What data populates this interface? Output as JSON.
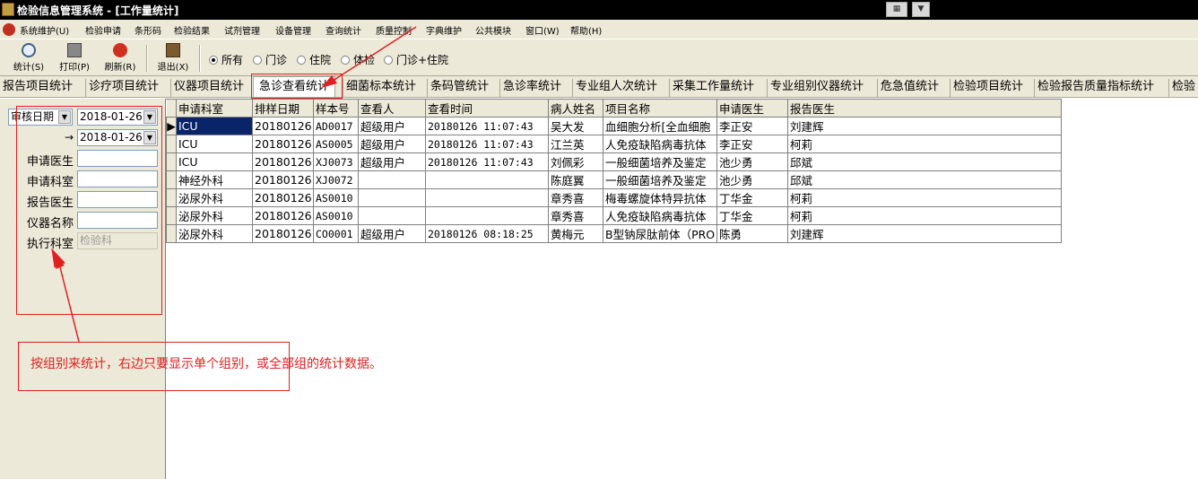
{
  "window": {
    "title": "检验信息管理系统 - [工作量统计]"
  },
  "menu": [
    "系统维护(U)",
    "检验申请",
    "条形码",
    "检验结果",
    "试剂管理",
    "设备管理",
    "查询统计",
    "质量控制",
    "字典维护",
    "公共模块",
    "窗口(W)",
    "帮助(H)"
  ],
  "toolbar": {
    "stats_label": "统计(S)",
    "print_label": "打印(P)",
    "refresh_label": "刷新(R)",
    "exit_label": "退出(X)"
  },
  "patient_filter": {
    "options": [
      "所有",
      "门诊",
      "住院",
      "体检",
      "门诊+住院"
    ],
    "selected": "所有"
  },
  "tabs": [
    "报告项目统计",
    "诊疗项目统计",
    "仪器项目统计",
    "急诊查看统计",
    "细菌标本统计",
    "条码管统计",
    "急诊率统计",
    "专业组人次统计",
    "采集工作量统计",
    "专业组别仪器统计",
    "危急值统计",
    "检验项目统计",
    "检验报告质量指标统计",
    "检验"
  ],
  "active_tab": "急诊查看统计",
  "filters": {
    "date_type": "审核日期",
    "date_from": "2018-01-26",
    "date_to": "2018-01-26",
    "to_arrow": "→",
    "labels": [
      "申请医生",
      "申请科室",
      "报告医生",
      "仪器名称",
      "执行科室"
    ],
    "exec_dept_value": "检验科"
  },
  "table": {
    "columns": [
      "申请科室",
      "排样日期",
      "样本号",
      "查看人",
      "查看时间",
      "病人姓名",
      "项目名称",
      "申请医生",
      "报告医生"
    ],
    "rows": [
      [
        "ICU",
        "20180126",
        "AD0017",
        "超级用户",
        "20180126 11:07:43",
        "吴大发",
        "血细胞分析[全血细胞",
        "李正安",
        "刘建辉"
      ],
      [
        "ICU",
        "20180126",
        "AS0005",
        "超级用户",
        "20180126 11:07:43",
        "江兰英",
        "人免疫缺陷病毒抗体",
        "李正安",
        "柯莉"
      ],
      [
        "ICU",
        "20180126",
        "XJ0073",
        "超级用户",
        "20180126 11:07:43",
        "刘佩彩",
        "一般细菌培养及鉴定",
        "池少勇",
        "邱斌"
      ],
      [
        "神经外科",
        "20180126",
        "XJ0072",
        "",
        "",
        "陈庭翼",
        "一般细菌培养及鉴定",
        "池少勇",
        "邱斌"
      ],
      [
        "泌尿外科",
        "20180126",
        "AS0010",
        "",
        "",
        "章秀喜",
        "梅毒螺旋体特异抗体",
        "丁华金",
        "柯莉"
      ],
      [
        "泌尿外科",
        "20180126",
        "AS0010",
        "",
        "",
        "章秀喜",
        "人免疫缺陷病毒抗体",
        "丁华金",
        "柯莉"
      ],
      [
        "泌尿外科",
        "20180126",
        "CO0001",
        "超级用户",
        "20180126 08:18:25",
        "黄梅元",
        "B型钠尿肽前体（PRO",
        "陈勇",
        "刘建辉"
      ]
    ],
    "selected_row": 0
  },
  "annotation": {
    "text": "按组别来统计，右边只要显示单个组别，或全部组的统计数据。",
    "color": "#e02020"
  },
  "colors": {
    "titlebar": "#000000",
    "chrome": "#ece9d8",
    "selection": "#0a246a",
    "annotation": "#e02020"
  }
}
